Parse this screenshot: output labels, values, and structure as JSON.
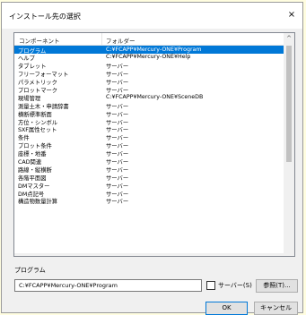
{
  "window": {
    "title": "インストール先の選択",
    "close": "×"
  },
  "list": {
    "columns": [
      "コンポーネント",
      "フォルダー"
    ],
    "rows": [
      {
        "name": "プログラム",
        "folder": "C:¥FCAPP¥Mercury-ONE¥Program"
      },
      {
        "name": "ヘルプ",
        "folder": "C:¥FCAPP¥Mercury-ONE¥Help"
      },
      {
        "name": "タブレット",
        "folder": "サーバー"
      },
      {
        "name": "フリーフォーマット",
        "folder": "サーバー"
      },
      {
        "name": "パラメトリック",
        "folder": "サーバー"
      },
      {
        "name": "プロットマーク",
        "folder": "サーバー"
      },
      {
        "name": "現場管理",
        "folder": "C:¥FCAPP¥Mercury-ONE¥SceneDB"
      },
      {
        "name": "測量土木・申請辞書",
        "folder": "サーバー"
      },
      {
        "name": "横断標準断面",
        "folder": "サーバー"
      },
      {
        "name": "方位・シンボル",
        "folder": "サーバー"
      },
      {
        "name": "SXF属性セット",
        "folder": "サーバー"
      },
      {
        "name": "条件",
        "folder": "サーバー"
      },
      {
        "name": "プロット条件",
        "folder": "サーバー"
      },
      {
        "name": "座標・地番",
        "folder": "サーバー"
      },
      {
        "name": "CAD関連",
        "folder": "サーバー"
      },
      {
        "name": "路線・縦横断",
        "folder": "サーバー"
      },
      {
        "name": "各階平面図",
        "folder": "サーバー"
      },
      {
        "name": "DMマスター",
        "folder": "サーバー"
      },
      {
        "name": "DM点記号",
        "folder": "サーバー"
      },
      {
        "name": "構造物数量計算",
        "folder": "サーバー"
      }
    ],
    "scroll_up": "^"
  },
  "program": {
    "label": "プログラム",
    "path": "C:¥FCAPP¥Mercury-ONE¥Program",
    "server_checkbox_label": "サーバー(S)",
    "browse_label": "参照(T)..."
  },
  "buttons": {
    "ok": "OK",
    "cancel": "キャンセル"
  },
  "colors": {
    "selection": "#0078d7",
    "background": "#f0f0f0"
  }
}
